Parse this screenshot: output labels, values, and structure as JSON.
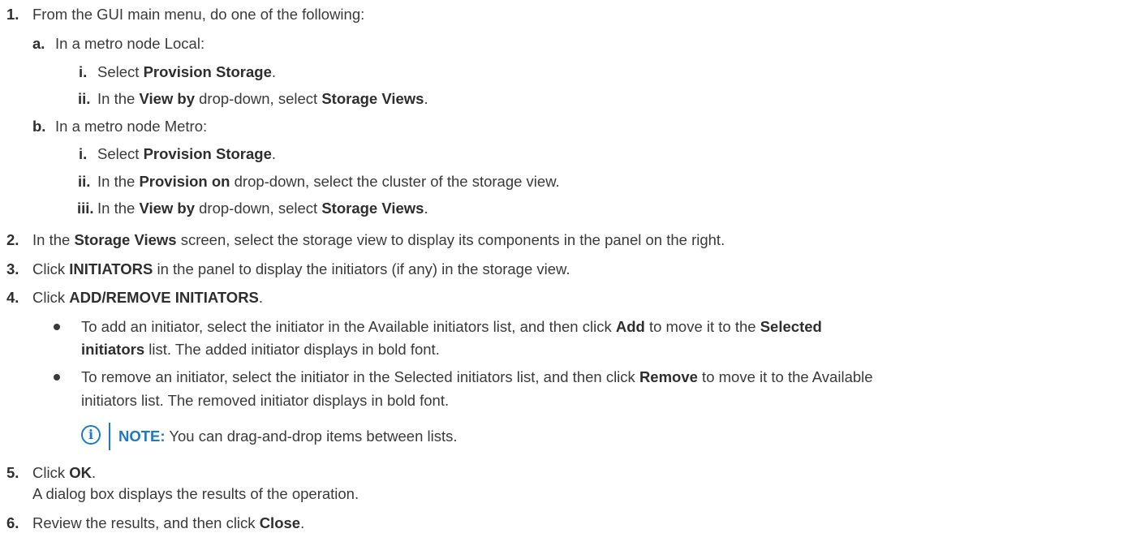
{
  "steps": {
    "s1": {
      "num": "1.",
      "text": "From the GUI main menu, do one of the following:",
      "a": {
        "label": "a.",
        "text": "In a metro node Local:",
        "i": {
          "label": "i.",
          "t1": "Select ",
          "b1": "Provision Storage",
          "t2": "."
        },
        "ii": {
          "label": "ii.",
          "t1": "In the ",
          "b1": "View by",
          "t2": " drop-down, select ",
          "b2": "Storage Views",
          "t3": "."
        }
      },
      "b": {
        "label": "b.",
        "text": "In a metro node Metro:",
        "i": {
          "label": "i.",
          "t1": "Select ",
          "b1": "Provision Storage",
          "t2": "."
        },
        "ii": {
          "label": "ii.",
          "t1": "In the ",
          "b1": "Provision on",
          "t2": " drop-down, select the cluster of the storage view."
        },
        "iii": {
          "label": "iii.",
          "t1": "In the ",
          "b1": "View by",
          "t2": " drop-down, select ",
          "b2": "Storage Views",
          "t3": "."
        }
      }
    },
    "s2": {
      "num": "2.",
      "t1": "In the ",
      "b1": "Storage Views",
      "t2": " screen, select the storage view to display its components in the panel on the right."
    },
    "s3": {
      "num": "3.",
      "t1": "Click ",
      "b1": "INITIATORS",
      "t2": " in the panel to display the initiators (if any) in the storage view."
    },
    "s4": {
      "num": "4.",
      "t1": "Click ",
      "b1": "ADD/REMOVE INITIATORS",
      "t2": ".",
      "bullet1": {
        "l1_t1": "To add an initiator, select the initiator in the Available initiators list, and then click ",
        "l1_b1": "Add",
        "l1_t2": " to move it to the ",
        "l1_b2": "Selected",
        "l2_b1": "initiators",
        "l2_t1": " list. The added initiator displays in bold font."
      },
      "bullet2": {
        "l1_t1": "To remove an initiator, select the initiator in the Selected initiators list, and then click ",
        "l1_b1": "Remove",
        "l1_t2": " to move it to the Available",
        "l2_t1": "initiators list. The removed initiator displays in bold font."
      },
      "note": {
        "icon": "info-icon",
        "label": "NOTE:",
        "text": " You can drag-and-drop items between lists."
      }
    },
    "s5": {
      "num": "5.",
      "t1": "Click ",
      "b1": "OK",
      "t2": ".",
      "sub": "A dialog box displays the results of the operation."
    },
    "s6": {
      "num": "6.",
      "t1": "Review the results, and then click ",
      "b1": "Close",
      "t2": "."
    }
  },
  "colors": {
    "text": "#3a3a3a",
    "note_accent": "#1a7ac4"
  }
}
